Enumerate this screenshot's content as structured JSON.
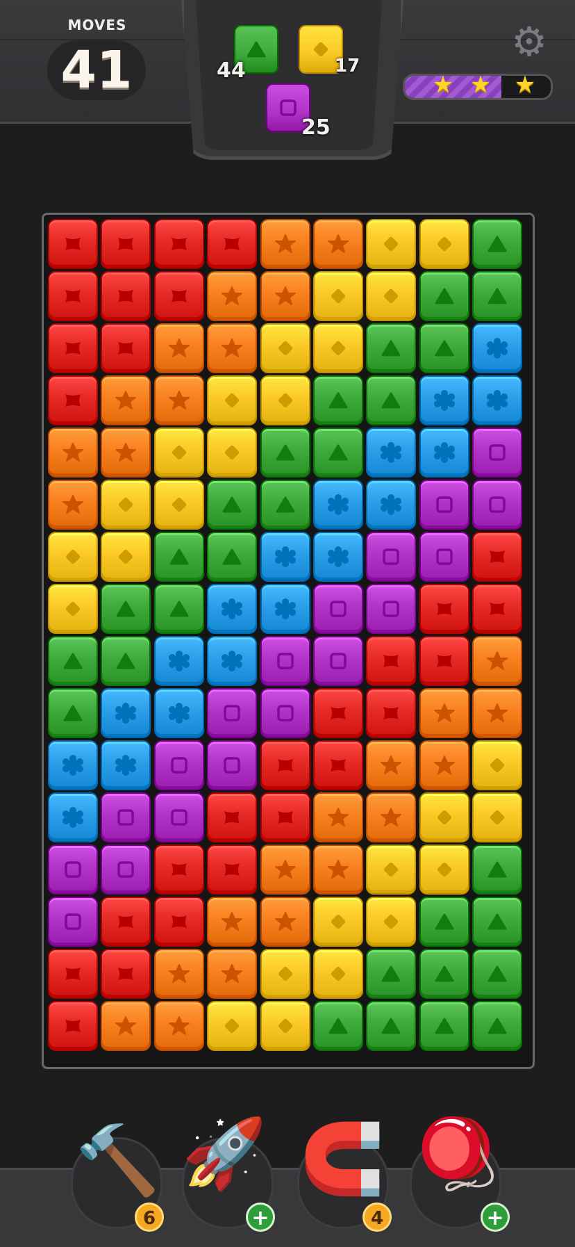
{
  "hud": {
    "moves_label": "MOVES",
    "moves_value": "41",
    "settings_icon": "gear-icon",
    "star_progress": 0.66,
    "stars": [
      "star-icon",
      "star-icon",
      "star-icon"
    ]
  },
  "goals": [
    {
      "color": "green",
      "icon": "triangle-block-icon",
      "count": "44"
    },
    {
      "color": "yellow",
      "icon": "diamond-block-icon",
      "count": "17"
    },
    {
      "color": "purple",
      "icon": "square-block-icon",
      "count": "25"
    }
  ],
  "palette": {
    "R": "#e52a26",
    "O": "#f9801f",
    "Y": "#fbc925",
    "G": "#3fa93b",
    "B": "#2a9ee8",
    "P": "#b234c7"
  },
  "board": {
    "rows": [
      "RRRROOYYG",
      "RRROOYYGG",
      "RROOYYGGB",
      "ROOYYGGBB",
      "OOYYGGBBP",
      "OYYGGBBPP",
      "YYGGBBPPR",
      "YGGBBPPRR",
      "GGBBPPRRO",
      "GBBPPRROO",
      "BBPPRROOY",
      "BPPRROOYY",
      "PPRROOYYG",
      "PRROOYYGG",
      "RROOYYGGG",
      "ROOYYGGGG"
    ]
  },
  "boosters": [
    {
      "name": "hammer",
      "icon": "hammer-icon",
      "badge_type": "count",
      "badge": "6"
    },
    {
      "name": "rocket",
      "icon": "rocket-icon",
      "badge_type": "plus",
      "badge": "+"
    },
    {
      "name": "magnet",
      "icon": "magnet-icon",
      "badge_type": "count",
      "badge": "4"
    },
    {
      "name": "yoyo",
      "icon": "yoyo-icon",
      "badge_type": "plus",
      "badge": "+"
    }
  ]
}
